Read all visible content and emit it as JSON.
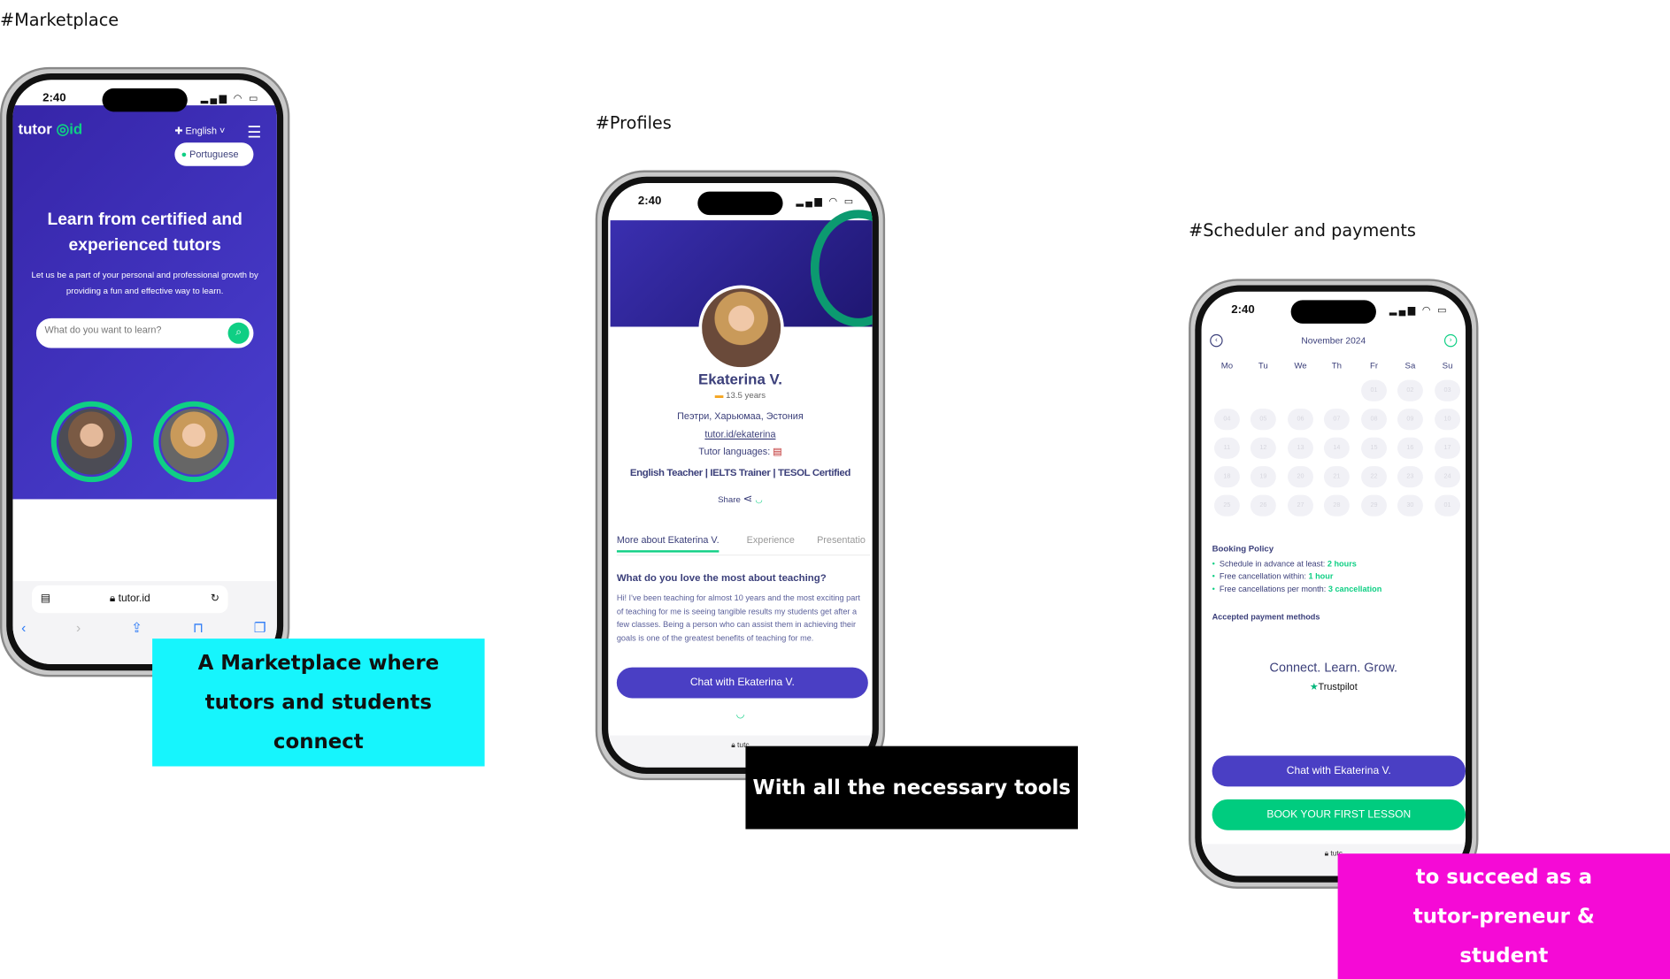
{
  "sections": {
    "marketplace": "#Marketplace",
    "profiles": "#Profiles",
    "scheduler": "#Scheduler and payments"
  },
  "callouts": {
    "cyan": "A Marketplace where tutors and students connect",
    "black": "With all the necessary tools",
    "magenta": "to succeed as a tutor-preneur & student"
  },
  "colors": {
    "brand": "#3a2fb8",
    "accent": "#0fcf84",
    "button": "#4a3fc4",
    "cyan": "#16f5fd",
    "magenta": "#f50ad6"
  },
  "status_time": "2:40",
  "marketplace": {
    "logo": "tutor id",
    "language": "English",
    "language_option": "Portuguese",
    "hero_title": "Learn from certified and experienced tutors",
    "hero_subtitle": "Let us be a part of your personal and professional growth by providing a fun and effective way to learn.",
    "search_placeholder": "What do you want to learn?",
    "url": "tutor.id"
  },
  "profile": {
    "name": "Ekaterina V.",
    "experience": "13.5 years",
    "location": "Пеэтри, Харьюмаа, Эстония",
    "link": "tutor.id/ekaterina",
    "languages_label": "Tutor languages:",
    "titles": "English Teacher | IELTS Trainer | TESOL Certified",
    "share": "Share",
    "tabs": [
      "More about Ekaterina V.",
      "Experience",
      "Presentatio"
    ],
    "question": "What do you love the most about teaching?",
    "answer": "Hi! I've been teaching for almost 10 years and the most exciting part of teaching for me is seeing tangible results my students get after a few classes. Being a person who can assist them in achieving their goals is one of the greatest benefits of teaching for me.",
    "chat_button": "Chat with Ekaterina V.",
    "url": "tutc"
  },
  "scheduler": {
    "month": "November 2024",
    "weekdays": [
      "Mo",
      "Tu",
      "We",
      "Th",
      "Fr",
      "Sa",
      "Su"
    ],
    "days": [
      "",
      "",
      "",
      "",
      "01",
      "02",
      "03",
      "04",
      "05",
      "06",
      "07",
      "08",
      "09",
      "10",
      "11",
      "12",
      "13",
      "14",
      "15",
      "16",
      "17",
      "18",
      "19",
      "20",
      "21",
      "22",
      "23",
      "24",
      "25",
      "26",
      "27",
      "28",
      "29",
      "30",
      "01"
    ],
    "policy_title": "Booking Policy",
    "policy": [
      {
        "label": "Schedule in advance at least:",
        "value": "2 hours"
      },
      {
        "label": "Free cancellation within:",
        "value": "1 hour"
      },
      {
        "label": "Free cancellations per month:",
        "value": "3 cancellation"
      }
    ],
    "payment_title": "Accepted payment methods",
    "slogan": "Connect. Learn. Grow.",
    "trustpilot": "Trustpilot",
    "chat_button": "Chat with Ekaterina V.",
    "book_button": "BOOK YOUR FIRST LESSON",
    "url": "tutc"
  }
}
